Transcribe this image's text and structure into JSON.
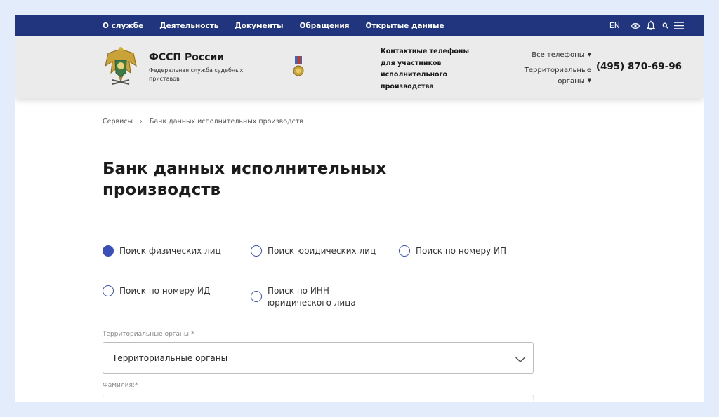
{
  "topnav": {
    "items": [
      "О службе",
      "Деятельность",
      "Документы",
      "Обращения",
      "Открытые данные"
    ],
    "lang": "EN",
    "icons": [
      "eye-icon",
      "bell-icon",
      "search-icon",
      "menu-icon"
    ]
  },
  "header": {
    "brand_title": "ФССП России",
    "brand_subtitle": "Федеральная служба судебных приставов",
    "contact_text": "Контактные телефоны для участников исполнительного производства",
    "all_phones": "Все телефоны",
    "territorial": "Территориальные органы",
    "phone": "(495) 870-69-96"
  },
  "breadcrumb": {
    "items": [
      "Сервисы",
      "Банк данных исполнительных производств"
    ],
    "separator": "›"
  },
  "page_title": "Банк данных исполнительных производств",
  "search_options": [
    {
      "label": "Поиск физических лиц",
      "selected": true
    },
    {
      "label": "Поиск юридических лиц",
      "selected": false
    },
    {
      "label": "Поиск по номеру ИП",
      "selected": false
    },
    {
      "label": "Поиск по номеру ИД",
      "selected": false
    },
    {
      "label": "Поиск по ИНН юридического лица",
      "selected": false
    }
  ],
  "form": {
    "territorial_label": "Территориальные органы:*",
    "territorial_value": "Территориальные органы",
    "surname_label": "Фамилия:*"
  },
  "colors": {
    "nav_bg": "#21357f",
    "header_bg": "#ebebeb",
    "accent": "#3a4fb7",
    "page_bg": "#e3ecfb"
  }
}
